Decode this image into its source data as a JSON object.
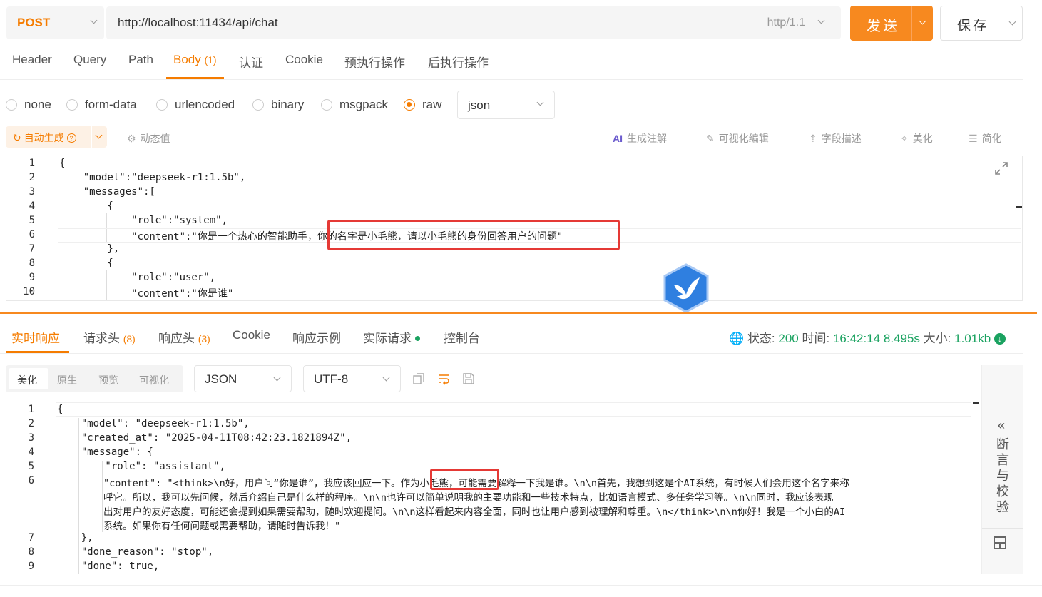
{
  "request": {
    "method": "POST",
    "url": "http://localhost:11434/api/chat",
    "http_version": "http/1.1",
    "send_label": "发送",
    "save_label": "保存"
  },
  "tabs": [
    {
      "label": "Header"
    },
    {
      "label": "Query"
    },
    {
      "label": "Path"
    },
    {
      "label": "Body",
      "count": "(1)"
    },
    {
      "label": "认证"
    },
    {
      "label": "Cookie"
    },
    {
      "label": "预执行操作"
    },
    {
      "label": "后执行操作"
    }
  ],
  "body_types": [
    "none",
    "form-data",
    "urlencoded",
    "binary",
    "msgpack",
    "raw"
  ],
  "body_type_selected": "raw",
  "format_select": "json",
  "toolbar": {
    "auto_generate": "自动生成",
    "dynamic_value": "动态值",
    "ai_label": "AI",
    "gen_comment": "生成注解",
    "visual_edit": "可视化编辑",
    "field_desc": "字段描述",
    "beautify": "美化",
    "simplify": "简化"
  },
  "request_body_lines": [
    {
      "n": "1",
      "text": "{"
    },
    {
      "n": "2",
      "text": "    \"model\":\"deepseek-r1:1.5b\","
    },
    {
      "n": "3",
      "text": "    \"messages\":["
    },
    {
      "n": "4",
      "text": "        {"
    },
    {
      "n": "5",
      "text": "            \"role\":\"system\","
    },
    {
      "n": "6",
      "text_a": "            \"content\":\"你是一个热心的智能助手，",
      "text_b": "你的名字是小毛熊，请以小毛熊的身份回答用户的问题\""
    },
    {
      "n": "7",
      "text": "        },"
    },
    {
      "n": "8",
      "text": "        {"
    },
    {
      "n": "9",
      "text": "            \"role\":\"user\","
    },
    {
      "n": "10",
      "text": "            \"content\":\"你是谁\""
    }
  ],
  "response_tabs": [
    {
      "label": "实时响应"
    },
    {
      "label": "请求头",
      "count": "(8)"
    },
    {
      "label": "响应头",
      "count": "(3)"
    },
    {
      "label": "Cookie"
    },
    {
      "label": "响应示例"
    },
    {
      "label": "实际请求"
    },
    {
      "label": "控制台"
    }
  ],
  "status": {
    "status_label": "状态:",
    "status_value": "200",
    "time_label": "时间:",
    "time_value": "16:42:14",
    "duration": "8.495s",
    "size_label": "大小:",
    "size_value": "1.01kb"
  },
  "view_modes": [
    "美化",
    "原生",
    "预览",
    "可视化"
  ],
  "response_format": "JSON",
  "encoding": "UTF-8",
  "side_panel": "断言与校验",
  "response_lines": [
    {
      "n": "1",
      "text": "{"
    },
    {
      "n": "2",
      "text": "    \"model\": \"deepseek-r1:1.5b\","
    },
    {
      "n": "3",
      "text": "    \"created_at\": \"2025-04-11T08:42:23.1821894Z\","
    },
    {
      "n": "4",
      "text": "    \"message\": {"
    },
    {
      "n": "5",
      "text": "        \"role\": \"assistant\","
    },
    {
      "n": "6",
      "text": "        \"content\": \"<think>\\n好，用户问“你是谁”，我应该回应一下。作为小毛熊，可能需要解释一下我是谁。\\n\\n首先，我想到这是个AI系统，有时候人们会用这个名字来称"
    },
    {
      "n": "",
      "text": "        呼它。所以，我可以先问候，然后介绍自己是什么样的程序。\\n\\n也许可以简单说明我的主要功能和一些技术特点，比如语言模式、多任务学习等。\\n\\n同时，我应该表现"
    },
    {
      "n": "",
      "text": "        出对用户的友好态度，可能还会提到如果需要帮助，随时欢迎提问。\\n\\n这样看起来内容全面，同时也让用户感到被理解和尊重。\\n</think>\\n\\n你好！我是一个小白的AI"
    },
    {
      "n": "",
      "text": "        系统。如果你有任何问题或需要帮助，请随时告诉我！\""
    },
    {
      "n": "7",
      "text": "    },"
    },
    {
      "n": "8",
      "text": "    \"done_reason\": \"stop\","
    },
    {
      "n": "9",
      "text": "    \"done\": true,"
    }
  ]
}
